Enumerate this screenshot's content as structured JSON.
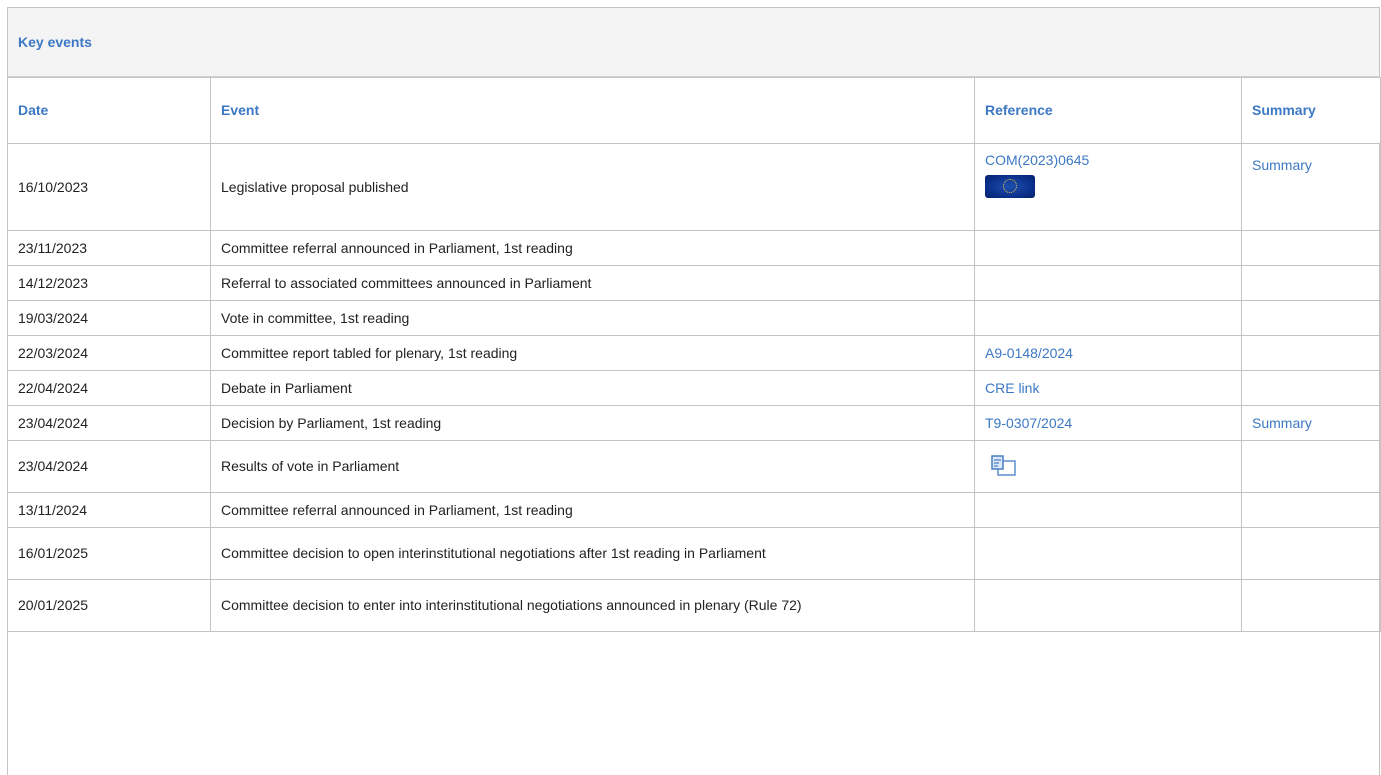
{
  "panel": {
    "title": "Key events"
  },
  "table": {
    "headers": {
      "date": "Date",
      "event": "Event",
      "reference": "Reference",
      "summary": "Summary"
    },
    "rows": [
      {
        "date": "16/10/2023",
        "event": "Legislative proposal published",
        "reference": "COM(2023)0645",
        "summary": "Summary"
      },
      {
        "date": "23/11/2023",
        "event": "Committee referral announced in Parliament, 1st reading",
        "reference": "",
        "summary": ""
      },
      {
        "date": "14/12/2023",
        "event": "Referral to associated committees announced in Parliament",
        "reference": "",
        "summary": ""
      },
      {
        "date": "19/03/2024",
        "event": "Vote in committee, 1st reading",
        "reference": "",
        "summary": ""
      },
      {
        "date": "22/03/2024",
        "event": "Committee report tabled for plenary, 1st reading",
        "reference": "A9-0148/2024",
        "summary": ""
      },
      {
        "date": "22/04/2024",
        "event": "Debate in Parliament",
        "reference": "CRE link",
        "summary": ""
      },
      {
        "date": "23/04/2024",
        "event": "Decision by Parliament, 1st reading",
        "reference": "T9-0307/2024",
        "summary": "Summary"
      },
      {
        "date": "23/04/2024",
        "event": "Results of vote in Parliament",
        "reference": "",
        "summary": ""
      },
      {
        "date": "13/11/2024",
        "event": "Committee referral announced in Parliament, 1st reading",
        "reference": "",
        "summary": ""
      },
      {
        "date": "16/01/2025",
        "event": "Committee decision to open interinstitutional negotiations after 1st reading in Parliament",
        "reference": "",
        "summary": ""
      },
      {
        "date": "20/01/2025",
        "event": "Committee decision to enter into interinstitutional negotiations announced in plenary (Rule 72)",
        "reference": "",
        "summary": ""
      }
    ]
  },
  "icons": {
    "eu_flag": "eu-flag-icon",
    "vote_results": "vote-results-icon"
  }
}
